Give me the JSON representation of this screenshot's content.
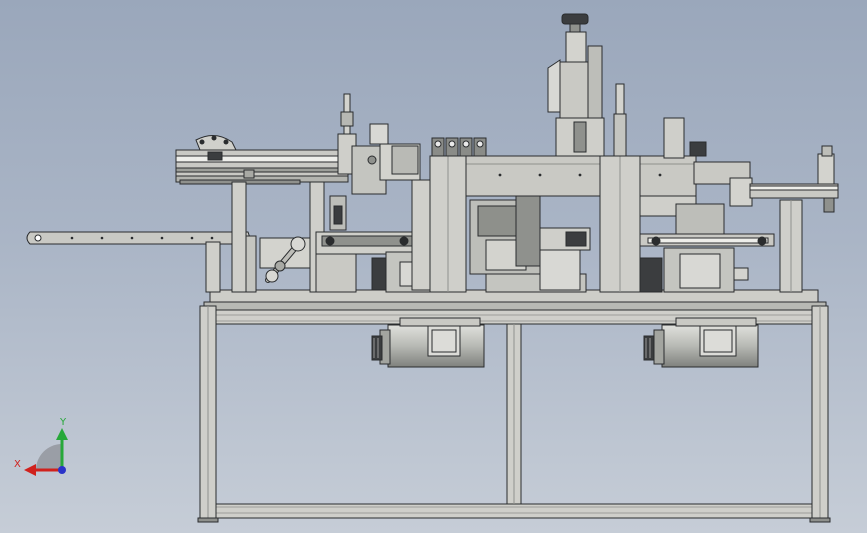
{
  "triad": {
    "x_label": "X",
    "y_label": "Y",
    "x_color": "#d0211d",
    "y_color": "#27a83a",
    "z_color": "#2a33c9"
  },
  "colors": {
    "background_top": "#9aa7bb",
    "background_bottom": "#c6cdd7",
    "metal": "#c9c9c4",
    "metal_dark": "#8f918d",
    "outline": "#2a2c2e",
    "motor": "#b9bbb6"
  }
}
